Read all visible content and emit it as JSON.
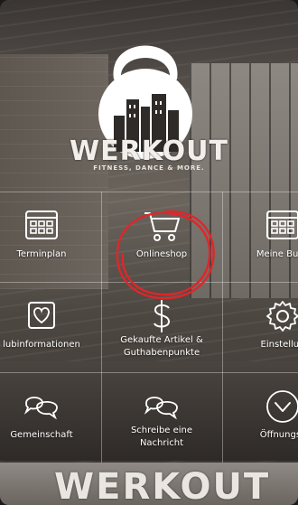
{
  "brand": {
    "name": "WERKOUT",
    "tagline": "FITNESS, DANCE & MORE."
  },
  "tiles": [
    {
      "label": "Terminplan",
      "icon": "calendar-icon"
    },
    {
      "label": "Onlineshop",
      "icon": "shopping-cart-icon"
    },
    {
      "label": "Meine Buch",
      "icon": "calendar-icon"
    },
    {
      "label": "lubinformationen",
      "icon": "heart-icon"
    },
    {
      "label": "Gekaufte Artikel &\nGuthabenpunkte",
      "icon": "dollar-icon"
    },
    {
      "label": "Einstellun",
      "icon": "gear-icon"
    },
    {
      "label": "Gemeinschaft",
      "icon": "chat-bubbles-icon"
    },
    {
      "label": "Schreibe eine\nNachricht",
      "icon": "chat-bubbles-icon"
    },
    {
      "label": "Öffnungsz",
      "icon": "chevron-down-icon"
    }
  ],
  "banner": {
    "text": "WERKOUT"
  },
  "colors": {
    "highlight": "#e0262a",
    "icon_stroke": "#ffffff"
  }
}
